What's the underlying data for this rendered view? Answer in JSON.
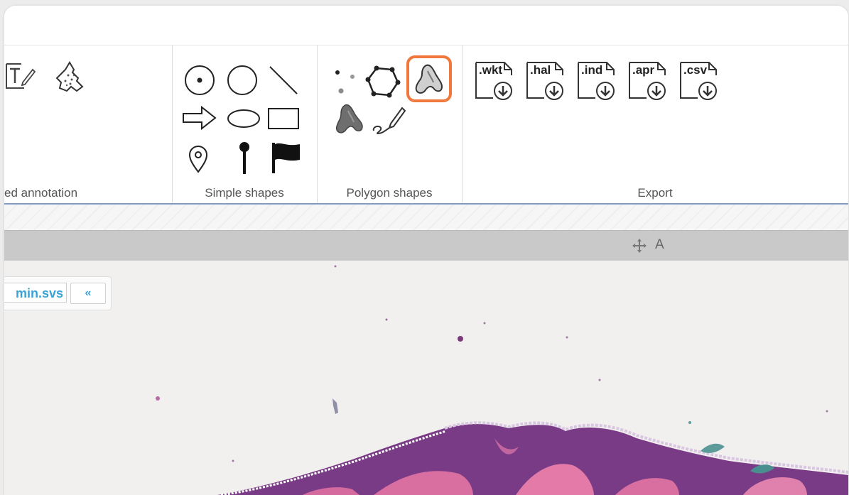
{
  "ribbon": {
    "groups": [
      {
        "name": "annotation",
        "label": "ed annotation"
      },
      {
        "name": "simple",
        "label": "Simple shapes"
      },
      {
        "name": "polygon",
        "label": "Polygon shapes"
      },
      {
        "name": "export",
        "label": "Export"
      }
    ],
    "export_formats": [
      ".wkt",
      ".hal",
      ".ind",
      ".apr",
      ".csv"
    ],
    "highlight_color": "#f0783c"
  },
  "viewer": {
    "header_text": "A",
    "file_name": "min.svs",
    "collapse_label": "«"
  },
  "icons": {
    "text": "text-annotation-icon",
    "tissue": "tissue-shape-icon",
    "point": "point-icon",
    "circle": "circle-icon",
    "line": "line-icon",
    "arrow": "arrow-icon",
    "ellipse": "ellipse-icon",
    "rectangle": "rectangle-icon",
    "pin": "map-pin-icon",
    "marker": "marker-pin-icon",
    "flag": "flag-icon",
    "dots": "point-set-icon",
    "polygon": "polygon-icon",
    "freehand": "freehand-area-icon",
    "filled": "filled-area-icon",
    "pen": "freehand-pen-icon",
    "move": "move-icon"
  }
}
